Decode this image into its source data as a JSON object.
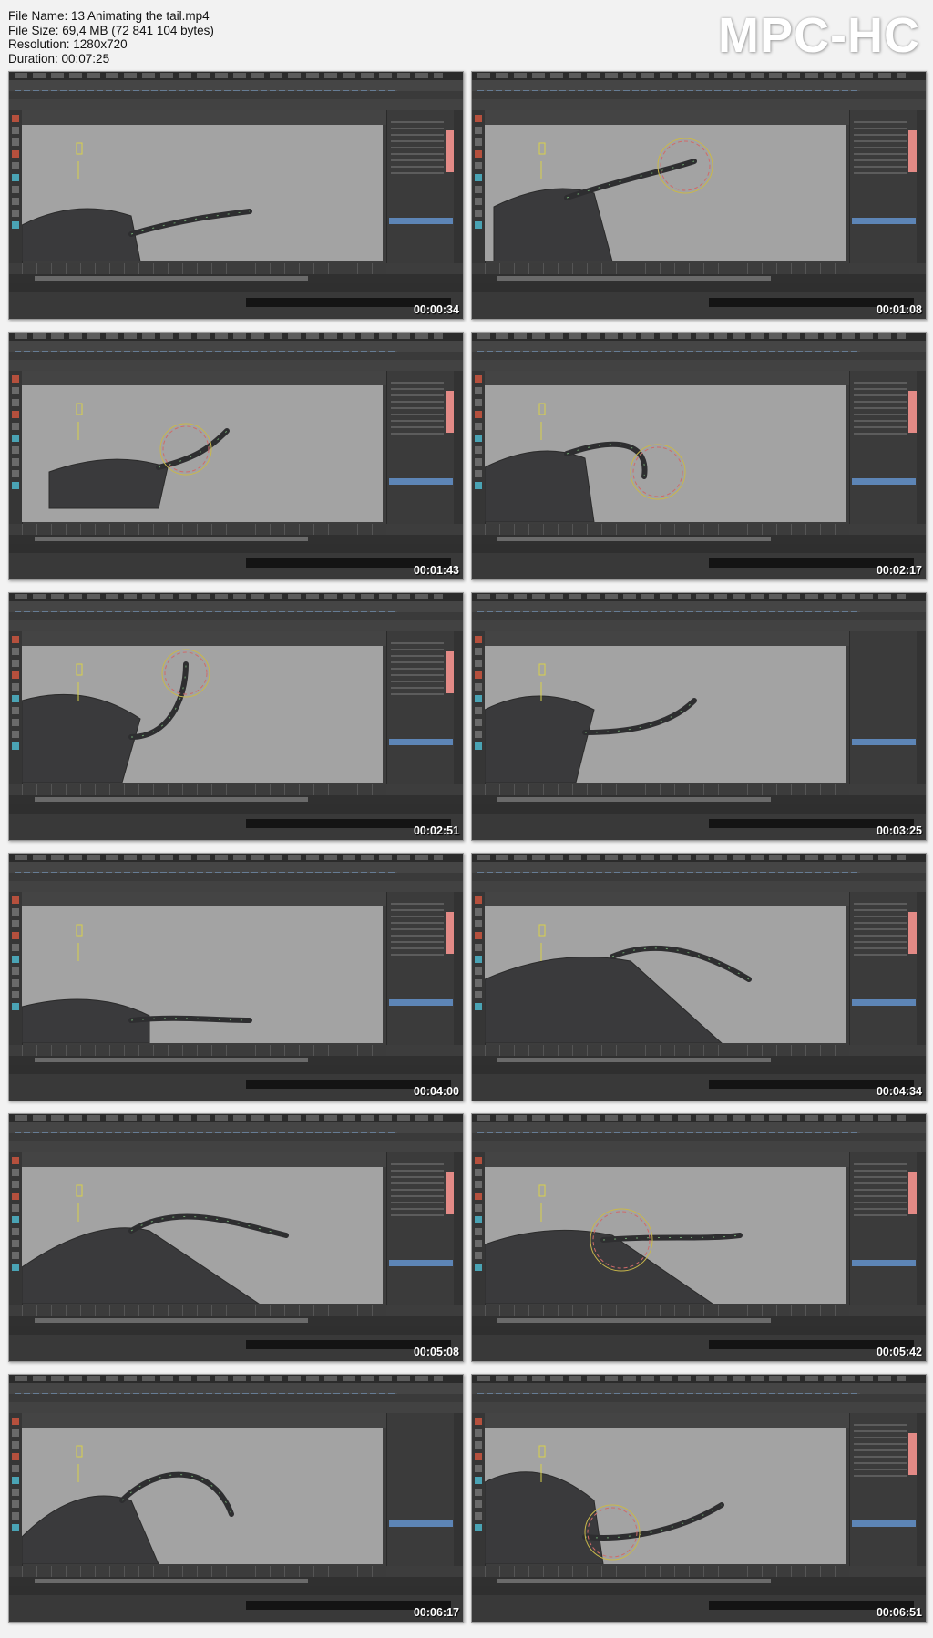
{
  "file_info": {
    "file_name": "File Name: 13 Animating the tail.mp4",
    "file_size": "File Size: 69,4 MB (72 841 104 bytes)",
    "resolution": "Resolution: 1280x720",
    "duration": "Duration: 00:07:25"
  },
  "logo": "MPC-HC",
  "colors": {
    "background": "#f2f2f2",
    "viewport": "#a3a3a3",
    "ui_dark": "#3d3d3d",
    "channel_box_highlight": "#e38a86",
    "layer_selected": "#5d85b6",
    "timestamp": "#ffffff"
  },
  "thumbnails": [
    {
      "timestamp": "00:00:34"
    },
    {
      "timestamp": "00:01:08"
    },
    {
      "timestamp": "00:01:43"
    },
    {
      "timestamp": "00:02:17"
    },
    {
      "timestamp": "00:02:51"
    },
    {
      "timestamp": "00:03:25"
    },
    {
      "timestamp": "00:04:00"
    },
    {
      "timestamp": "00:04:34"
    },
    {
      "timestamp": "00:05:08"
    },
    {
      "timestamp": "00:05:42"
    },
    {
      "timestamp": "00:06:17"
    },
    {
      "timestamp": "00:06:51"
    }
  ]
}
